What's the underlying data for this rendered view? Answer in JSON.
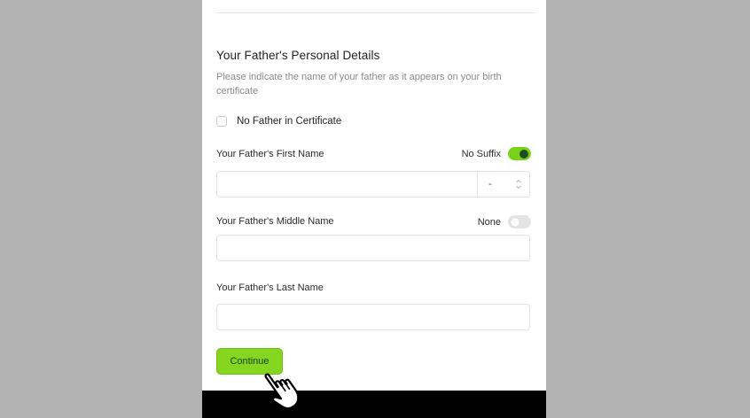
{
  "section": {
    "title": "Your Father's Personal Details",
    "description": "Please indicate the name of your father as it appears on your birth certificate"
  },
  "no_father_checkbox": {
    "label": "No Father in Certificate",
    "checked": false
  },
  "first_name": {
    "label": "Your Father's First Name",
    "value": "",
    "toggle_label": "No Suffix",
    "toggle_on": true,
    "suffix_value": "-"
  },
  "middle_name": {
    "label": "Your Father's Middle Name",
    "value": "",
    "toggle_label": "None",
    "toggle_on": false
  },
  "last_name": {
    "label": "Your Father's Last Name",
    "value": ""
  },
  "continue_button": {
    "label": "Continue"
  },
  "colors": {
    "accent": "#84d61e",
    "toggle_on": "#7ad11a",
    "backdrop": "#b3b3b3"
  },
  "icons": {
    "cursor": "hand-pointer-icon",
    "stepper": "up-down-stepper-icon"
  }
}
